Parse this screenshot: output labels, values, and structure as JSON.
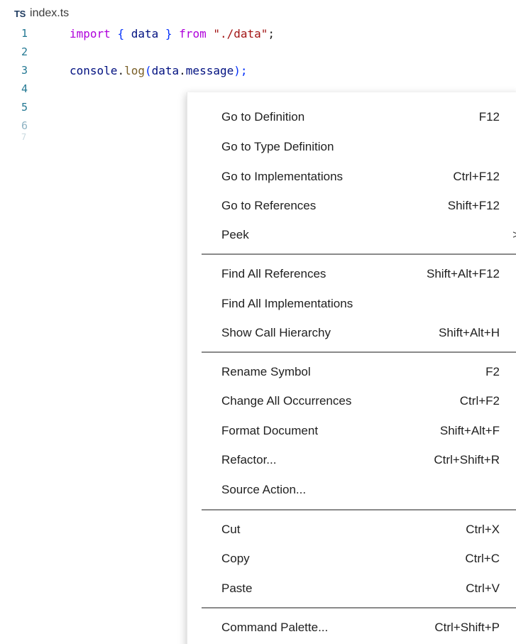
{
  "tab": {
    "icon_text": "TS",
    "file_name": "index.ts"
  },
  "editor": {
    "line_numbers": [
      "1",
      "2",
      "3",
      "4",
      "5",
      "6",
      "7"
    ],
    "line1": {
      "kw_import": "import",
      "open_brace": "{",
      "ident": "data",
      "close_brace": "}",
      "kw_from": "from",
      "path": "\"./data\"",
      "semi": ";"
    },
    "line3": {
      "obj": "console",
      "dot1": ".",
      "method": "log",
      "open_paren": "(",
      "arg_obj": "data",
      "dot2": ".",
      "arg_prop": "message",
      "close": ");"
    }
  },
  "context_menu": {
    "items": [
      {
        "label": "Go to Definition",
        "shortcut": "F12"
      },
      {
        "label": "Go to Type Definition",
        "shortcut": ""
      },
      {
        "label": "Go to Implementations",
        "shortcut": "Ctrl+F12"
      },
      {
        "label": "Go to References",
        "shortcut": "Shift+F12"
      },
      {
        "label": "Peek",
        "shortcut": "",
        "submenu_arrow": ">"
      },
      {
        "label": "Find All References",
        "shortcut": "Shift+Alt+F12"
      },
      {
        "label": "Find All Implementations",
        "shortcut": ""
      },
      {
        "label": "Show Call Hierarchy",
        "shortcut": "Shift+Alt+H"
      },
      {
        "label": "Rename Symbol",
        "shortcut": "F2"
      },
      {
        "label": "Change All Occurrences",
        "shortcut": "Ctrl+F2"
      },
      {
        "label": "Format Document",
        "shortcut": "Shift+Alt+F"
      },
      {
        "label": "Refactor...",
        "shortcut": "Ctrl+Shift+R"
      },
      {
        "label": "Source Action...",
        "shortcut": ""
      },
      {
        "label": "Cut",
        "shortcut": "Ctrl+X"
      },
      {
        "label": "Copy",
        "shortcut": "Ctrl+C"
      },
      {
        "label": "Paste",
        "shortcut": "Ctrl+V"
      },
      {
        "label": "Command Palette...",
        "shortcut": "Ctrl+Shift+P"
      }
    ]
  },
  "colors": {
    "keyword": "#af00db",
    "string": "#a31515",
    "variable": "#001080",
    "function": "#795e26",
    "line_number": "#237893",
    "separator": "#8a8a8a"
  },
  "icons": {
    "file_type": "typescript-file-icon",
    "submenu": "chevron-right-icon"
  }
}
